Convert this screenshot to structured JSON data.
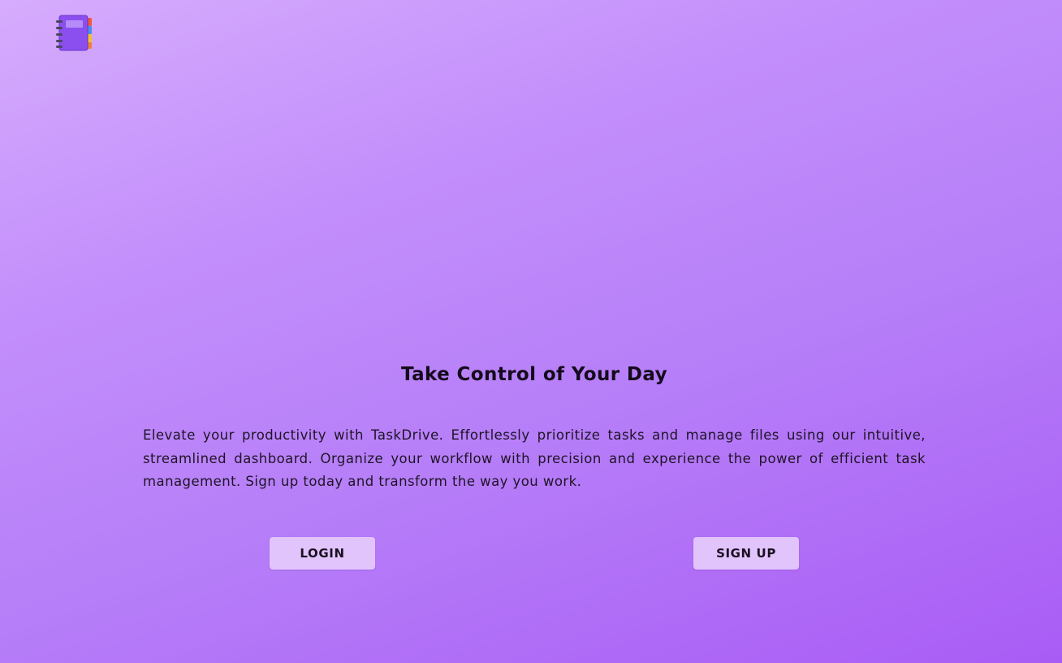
{
  "header": {
    "logo_icon": "notebook-icon"
  },
  "hero": {
    "title": "Take Control of Your Day",
    "description": "Elevate your productivity with TaskDrive. Effortlessly prioritize tasks and manage files using our intuitive, streamlined dashboard. Organize your workflow with precision and experience the power of efficient task management. Sign up today and transform the way you work."
  },
  "actions": {
    "login_label": "LOGIN",
    "signup_label": "SIGN UP"
  },
  "colors": {
    "background_start": "#d6acfd",
    "background_end": "#a95cf5",
    "button_bg": "#e2c4fd",
    "logo_cover": "#8b4ff0"
  }
}
